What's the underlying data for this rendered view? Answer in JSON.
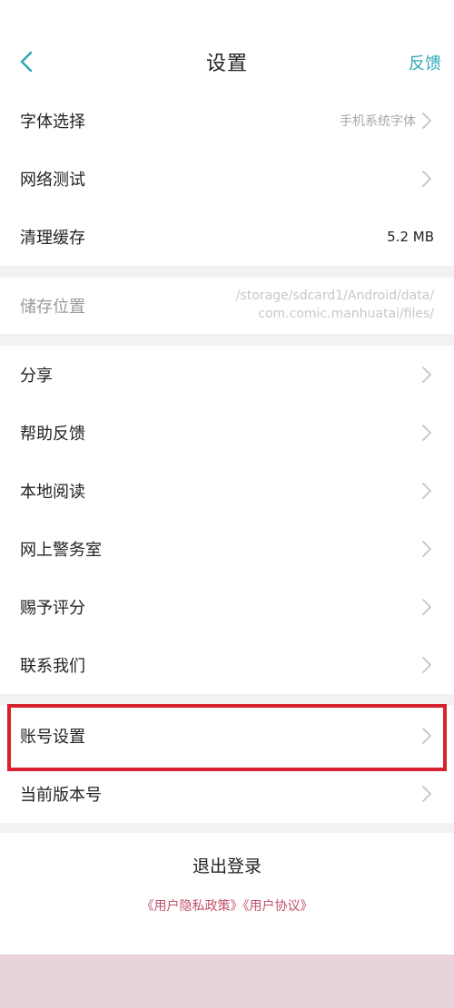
{
  "header": {
    "title": "设置",
    "feedback_label": "反馈",
    "back_icon": "chevron-left-icon",
    "accent_color": "#2fa8b8"
  },
  "group1": {
    "font": {
      "label": "字体选择",
      "hint": "手机系统字体"
    },
    "network": {
      "label": "网络测试"
    },
    "cache": {
      "label": "清理缓存",
      "value": "5.2 MB"
    }
  },
  "storage": {
    "label": "储存位置",
    "path_line1": "/storage/sdcard1/Android/data/",
    "path_line2": "com.comic.manhuatai/files/"
  },
  "group2": {
    "share": {
      "label": "分享"
    },
    "help": {
      "label": "帮助反馈"
    },
    "local": {
      "label": "本地阅读"
    },
    "police": {
      "label": "网上警务室"
    },
    "rate": {
      "label": "赐予评分"
    },
    "contact": {
      "label": "联系我们"
    }
  },
  "group3": {
    "account": {
      "label": "账号设置"
    },
    "version": {
      "label": "当前版本号"
    }
  },
  "footer": {
    "logout_label": "退出登录",
    "privacy_link": "《用户隐私政策》",
    "agreement_link": "《用户协议》",
    "link_color": "#c0506a"
  },
  "highlight_color": "#d6222d"
}
